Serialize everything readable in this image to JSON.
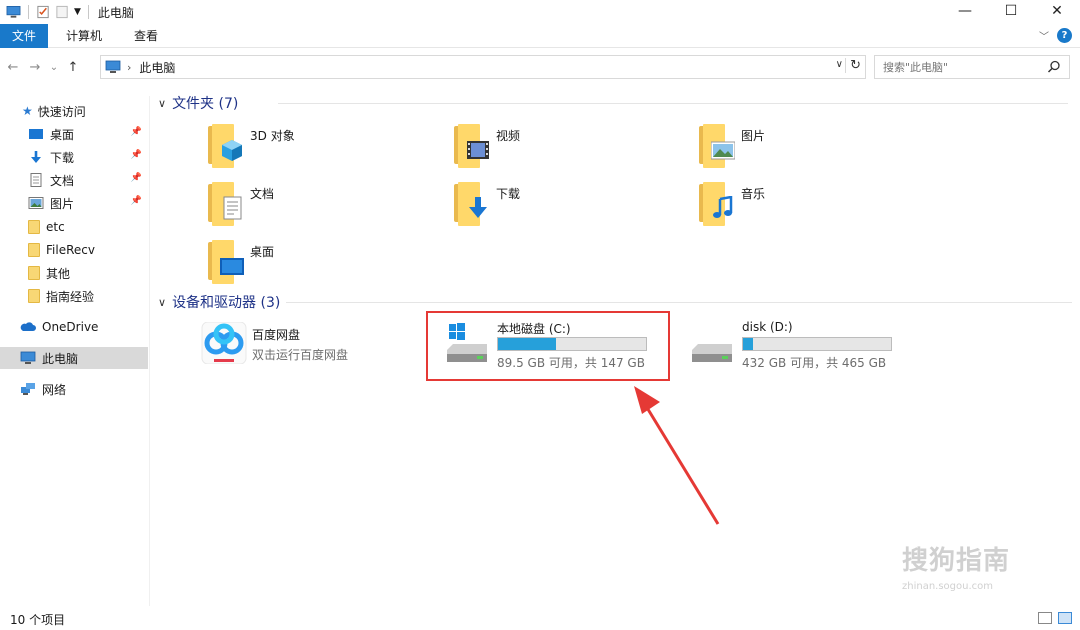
{
  "window": {
    "title": "此电脑",
    "minimize": "—",
    "maximize": "☐",
    "close": "✕"
  },
  "ribbon": {
    "file_tab": "文件",
    "tabs": [
      "计算机",
      "查看"
    ],
    "collapse": "﹀",
    "help": "?"
  },
  "nav": {
    "back": "←",
    "forward": "→",
    "recent": "⌄",
    "up": "↑",
    "breadcrumb": "此电脑",
    "crumb_sep": "›",
    "refresh": "↻",
    "dropdown": "∨"
  },
  "search": {
    "placeholder": "搜索\"此电脑\""
  },
  "sidebar": {
    "quick_access": "快速访问",
    "pinned": [
      {
        "label": "桌面",
        "icon": "desktop-icon"
      },
      {
        "label": "下载",
        "icon": "download-icon"
      },
      {
        "label": "文档",
        "icon": "document-icon"
      },
      {
        "label": "图片",
        "icon": "picture-icon"
      }
    ],
    "folders": [
      "etc",
      "FileRecv",
      "其他",
      "指南经验"
    ],
    "onedrive": "OneDrive",
    "this_pc": "此电脑",
    "network": "网络"
  },
  "sections": {
    "folders_header": "文件夹 (7)",
    "devices_header": "设备和驱动器 (3)"
  },
  "folders": [
    {
      "label": "3D 对象",
      "icon": "3d-objects-icon"
    },
    {
      "label": "视频",
      "icon": "video-icon"
    },
    {
      "label": "图片",
      "icon": "pictures-icon"
    },
    {
      "label": "文档",
      "icon": "documents-icon"
    },
    {
      "label": "下载",
      "icon": "downloads-icon"
    },
    {
      "label": "音乐",
      "icon": "music-icon"
    },
    {
      "label": "桌面",
      "icon": "desktop-icon"
    }
  ],
  "devices": [
    {
      "name": "百度网盘",
      "subtitle": "双击运行百度网盘",
      "icon": "baidu-netdisk-icon"
    },
    {
      "name": "本地磁盘 (C:)",
      "free": "89.5 GB 可用，共 147 GB",
      "used_fraction": 0.39,
      "icon": "windows-drive-icon"
    },
    {
      "name": "disk (D:)",
      "free": "432 GB 可用，共 465 GB",
      "used_fraction": 0.07,
      "icon": "hard-drive-icon"
    }
  ],
  "status": {
    "item_count": "10 个项目"
  },
  "watermark": {
    "text": "搜狗指南",
    "url": "zhinan.sogou.com"
  },
  "colors": {
    "accent": "#1979ca",
    "drive_fill": "#26a0da",
    "annotation": "#e53935",
    "section_header": "#1e3287"
  }
}
